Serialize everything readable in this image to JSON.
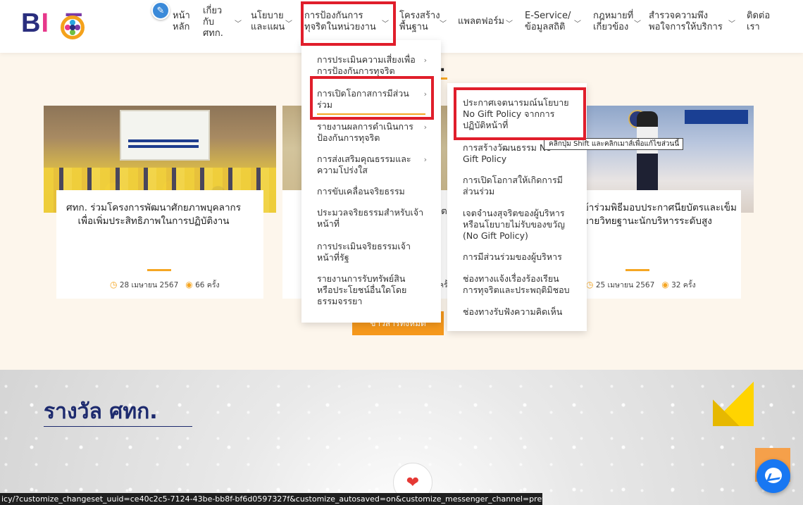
{
  "header": {
    "logo_text": "BICT",
    "nav": [
      {
        "label": "หน้า\nหลัก"
      },
      {
        "label": "เกี่ยว\nกับ\nศทก."
      },
      {
        "label": "นโยบาย\nและแผน"
      },
      {
        "label": "การป้องกันการ\nทุจริตในหน่วยงาน"
      },
      {
        "label": "โครงสร้าง\nพื้นฐาน"
      },
      {
        "label": "แพลตฟอร์ม"
      },
      {
        "label": "E-Service/\nข้อมูลสถิติ"
      },
      {
        "label": "กฎหมายที่\nเกี่ยวข้อง"
      },
      {
        "label": "สำรวจความพึง\nพอใจการให้บริการ"
      },
      {
        "label": "ติดต่อ\nเรา"
      }
    ]
  },
  "dropdown1": {
    "items": [
      {
        "label": "การประเมินความเสี่ยงเพื่อ\nการป้องกันการทุจริต"
      },
      {
        "label": "การเปิดโอกาสการมีส่วน\nร่วม"
      },
      {
        "label": "รายงานผลการดำเนินการ\nป้องกันการทุจริต"
      },
      {
        "label": "การส่งเสริมคุณธรรมและ\nความโปร่งใส"
      },
      {
        "label": "การขับเคลื่อนจริยธรรม"
      },
      {
        "label": "ประมวลจริยธรรมสำหรับเจ้า\nหน้าที่"
      },
      {
        "label": "การประเมินจริยธรรมเจ้า\nหน้าที่รัฐ"
      },
      {
        "label": "รายงานการรับทรัพย์สิน\nหรือประโยชน์อื่นใดโดย\nธรรมจรรยา"
      }
    ]
  },
  "dropdown2": {
    "items": [
      {
        "label": "ประกาศเจตนารมณ์นโยบาย\nNo Gift Policy จากการ\nปฏิบัติหน้าที่"
      },
      {
        "label": "การสร้างวัฒนธรรม No\nGift Policy"
      },
      {
        "label": "การเปิดโอกาสให้เกิดการมี\nส่วนร่วม"
      },
      {
        "label": "เจตจำนงสุจริตของผู้บริหาร\nหรือนโยบายไม่รับของขวัญ\n(No Gift Policy)"
      },
      {
        "label": "การมีส่วนร่วมของผู้บริหาร"
      },
      {
        "label": "ช่องทางแจ้งเรื่องร้องเรียน\nการทุจริตและประพฤติมิชอบ"
      },
      {
        "label": "ช่องทางรับฟังความคิดเห็น"
      }
    ]
  },
  "tooltip": "คลิกปุ่ม Shift และคลิกเมาส์เพื่อแก้ไขส่วนนี้",
  "news": {
    "title_peek": ".",
    "cards": [
      {
        "title": "ศทก. ร่วมโครงการพัฒนาศักยภาพบุคลากร\nเพื่อเพิ่มประสิทธิภาพในการปฏิบัติงาน",
        "date": "28 เมษายน 2567",
        "views": "66 ครั้ง"
      },
      {
        "title_peek": "ต",
        "date_peek": "ครั้"
      },
      {
        "title": "..ข้าร่วมพิธีมอบประกาศนียบัตรและเข็ม\nหมายวิทยฐานะนักบริหารระดับสูง",
        "date": "25 เมษายน 2567",
        "views": "32 ครั้ง"
      }
    ],
    "more_button": "ข่าวสารทั้งหมด"
  },
  "awards": {
    "title": "รางวัล ศทก."
  },
  "status_bar": "icy/?customize_changeset_uuid=ce40c2c5-7124-43be-bb8f-bf6d0597327f&customize_autosaved=on&customize_messenger_channel=preview-0"
}
